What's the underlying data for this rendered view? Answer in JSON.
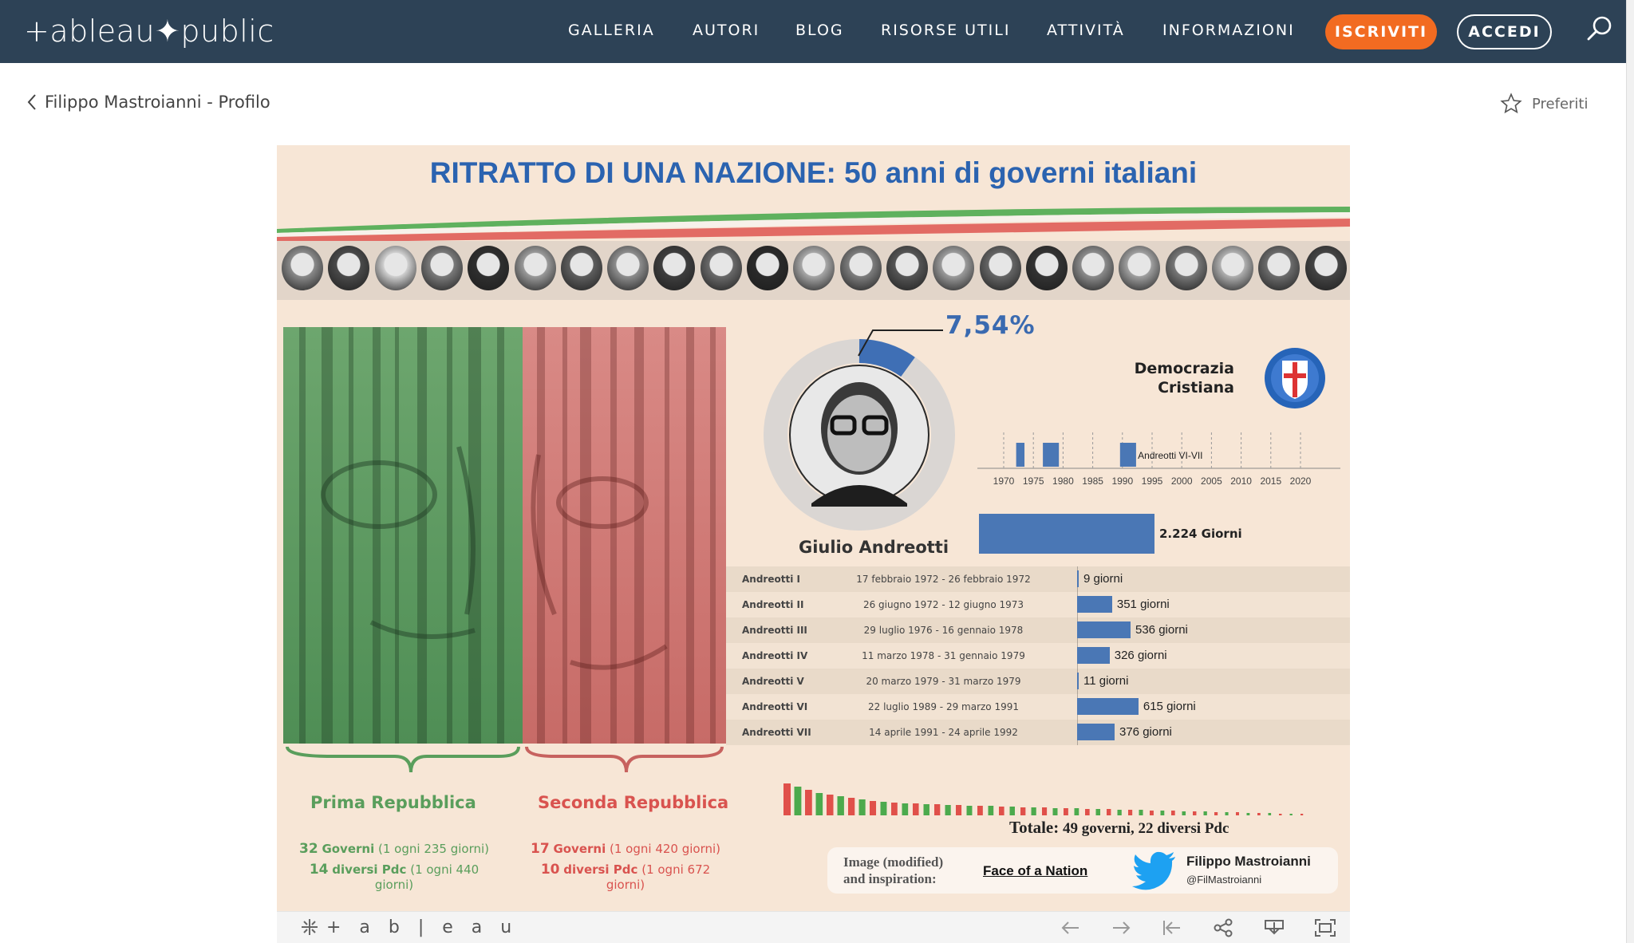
{
  "nav": {
    "logo": "+ableau✦public",
    "items": [
      "GALLERIA",
      "AUTORI",
      "BLOG",
      "RISORSE UTILI",
      "ATTIVITÀ",
      "INFORMAZIONI"
    ],
    "join_label": "ISCRIVITI",
    "login_label": "ACCEDI",
    "search_icon": "search-icon",
    "accent": "#f26b21",
    "background": "#2d4256"
  },
  "subheader": {
    "back_label": "Filippo Mastroianni - Profilo",
    "fav_label": "Preferiti"
  },
  "viz": {
    "title": "RITRATTO DI UNA NAZIONE: 50 anni di governi italiani",
    "percent": "7,54%",
    "pm_name": "Giulio Andreotti",
    "party_line1": "Democrazia",
    "party_line2": "Cristiana",
    "timeline_label": "Andreotti VI-VII",
    "timeline_ticks": [
      "1970",
      "1975",
      "1980",
      "1985",
      "1990",
      "1995",
      "2000",
      "2005",
      "2010",
      "2015",
      "2020"
    ],
    "total_days_label": "2.224 Giorni",
    "governments": [
      {
        "name": "Andreotti I",
        "dates": "17 febbraio 1972 - 26 febbraio 1972",
        "days": 9,
        "label": "9 giorni"
      },
      {
        "name": "Andreotti II",
        "dates": "26 giugno 1972 - 12 giugno 1973",
        "days": 351,
        "label": "351 giorni"
      },
      {
        "name": "Andreotti III",
        "dates": "29 luglio 1976 - 16 gennaio 1978",
        "days": 536,
        "label": "536 giorni"
      },
      {
        "name": "Andreotti IV",
        "dates": "11 marzo 1978 - 31 gennaio 1979",
        "days": 326,
        "label": "326 giorni"
      },
      {
        "name": "Andreotti V",
        "dates": "20 marzo 1979 - 31 marzo 1979",
        "days": 11,
        "label": "11 giorni"
      },
      {
        "name": "Andreotti VI",
        "dates": "22 luglio 1989 - 29 marzo 1991",
        "days": 615,
        "label": "615 giorni"
      },
      {
        "name": "Andreotti VII",
        "dates": "14 aprile 1991 - 24 aprile 1992",
        "days": 376,
        "label": "376 giorni"
      }
    ],
    "prima": {
      "title": "Prima Repubblica",
      "gov_num": "32",
      "gov_word": "Governi",
      "gov_rate": "(1 ogni 235 giorni)",
      "pdc_num": "14",
      "pdc_word": "diversi Pdc",
      "pdc_rate": "(1 ogni 440 giorni)",
      "color": "#5a9e5c"
    },
    "seconda": {
      "title": "Seconda Repubblica",
      "gov_num": "17",
      "gov_word": "Governi",
      "gov_rate": "(1 ogni 420 giorni)",
      "pdc_num": "10",
      "pdc_word": "diversi Pdc",
      "pdc_rate": "(1 ogni 672 giorni)",
      "color": "#d9534f"
    },
    "totale_prefix": "Totale:",
    "totale_text": "49 governi, 22 diversi Pdc",
    "credit_line1": "Image (modified)",
    "credit_line2": "and inspiration:",
    "credit_link": "Face of a Nation",
    "author": "Filippo Mastroianni",
    "handle": "@FilMastroianni"
  },
  "toolbar": {
    "logo": "+ a b | e a u",
    "buttons": [
      "undo-icon",
      "redo-icon",
      "revert-icon",
      "share-icon",
      "download-icon",
      "fullscreen-icon"
    ]
  }
}
